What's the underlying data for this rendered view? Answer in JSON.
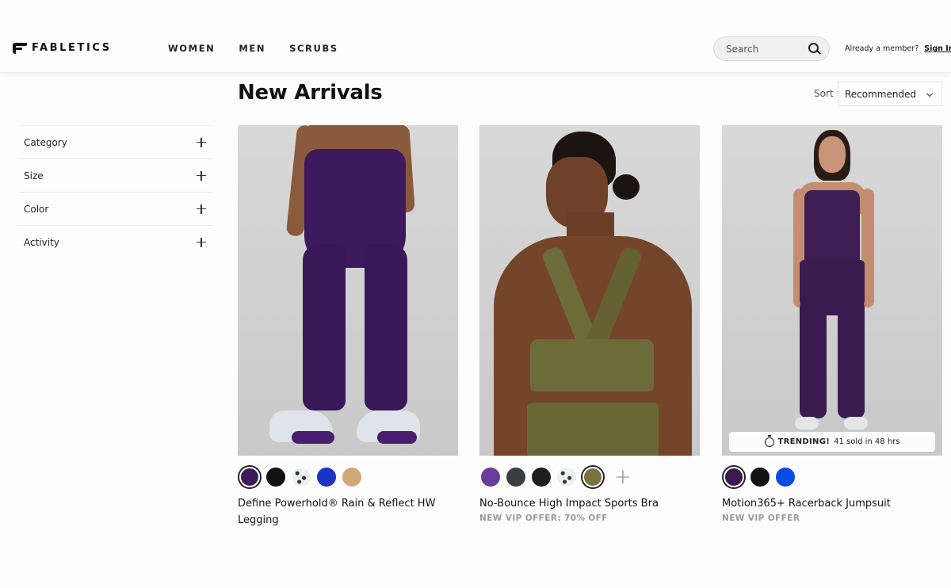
{
  "header": {
    "brand": "FABLETICS",
    "nav": [
      "WOMEN",
      "MEN",
      "SCRUBS"
    ],
    "search": {
      "placeholder": "Search",
      "value": ""
    },
    "member_prompt": "Already a member?",
    "sign_in": "Sign In"
  },
  "page": {
    "title": "New Arrivals",
    "sort": {
      "label": "Sort",
      "selected": "Recommended"
    }
  },
  "filters": [
    "Category",
    "Size",
    "Color",
    "Activity"
  ],
  "products": [
    {
      "name": "Define Powerhold® Rain & Reflect HW Legging",
      "offer": "",
      "badge": null,
      "garment_color": "#3d1a5e",
      "swatches": [
        {
          "color": "#3b1c58",
          "selected": true,
          "pattern": false
        },
        {
          "color": "#111111",
          "selected": false,
          "pattern": false
        },
        {
          "color": "#eef0f2",
          "selected": false,
          "pattern": true
        },
        {
          "color": "#1a33c4",
          "selected": false,
          "pattern": false
        },
        {
          "color": "#d2a878",
          "selected": false,
          "pattern": false
        }
      ],
      "more_swatches": false
    },
    {
      "name": "No-Bounce High Impact Sports Bra",
      "offer": "NEW VIP OFFER: 70% OFF",
      "badge": null,
      "garment_color": "#6e6b3a",
      "swatches": [
        {
          "color": "#6a3c9c",
          "selected": false,
          "pattern": false
        },
        {
          "color": "#3c3d42",
          "selected": false,
          "pattern": false
        },
        {
          "color": "#1f1f1f",
          "selected": false,
          "pattern": false
        },
        {
          "color": "#eef0f2",
          "selected": false,
          "pattern": true
        },
        {
          "color": "#7a7340",
          "selected": true,
          "pattern": false
        }
      ],
      "more_swatches": true,
      "more_label": "+"
    },
    {
      "name": "Motion365+ Racerback Jumpsuit",
      "offer": "NEW VIP OFFER",
      "badge": {
        "strong": "TRENDING!",
        "text": "41 sold in 48 hrs",
        "icon": "timer-icon"
      },
      "garment_color": "#3f1d55",
      "swatches": [
        {
          "color": "#3a1a50",
          "selected": true,
          "pattern": false
        },
        {
          "color": "#121212",
          "selected": false,
          "pattern": false
        },
        {
          "color": "#0a4be6",
          "selected": false,
          "pattern": false
        }
      ],
      "more_swatches": false
    }
  ]
}
